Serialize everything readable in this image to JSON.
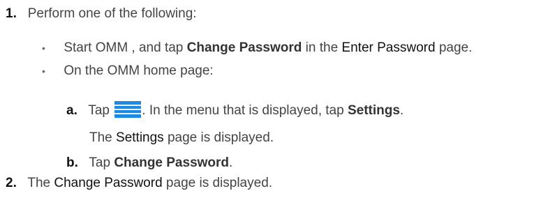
{
  "steps": [
    {
      "num": "1.",
      "text": "Perform one of the following:"
    },
    {
      "num": "2.",
      "pre": "The ",
      "ui": "Change Password",
      "post": " page is displayed."
    }
  ],
  "bullets": [
    {
      "marker": "•",
      "pre": "Start OMM , and tap ",
      "bold": "Change Password",
      "mid": " in the ",
      "ui": "Enter Password",
      "post": " page."
    },
    {
      "marker": "•",
      "text": "On the OMM home page:"
    }
  ],
  "substeps": [
    {
      "letter": "a.",
      "pre": "Tap ",
      "mid": ". In the menu that is displayed, tap ",
      "bold": "Settings",
      "post": ".",
      "icon": "menu-icon"
    },
    {
      "letter": "b.",
      "pre": "Tap ",
      "bold": "Change Password",
      "post": "."
    }
  ],
  "result": {
    "pre": "The ",
    "ui": "Settings",
    "post": " page is displayed."
  },
  "colors": {
    "icon_blue": "#1e88e5",
    "icon_stripe": "#e3f2fd"
  }
}
